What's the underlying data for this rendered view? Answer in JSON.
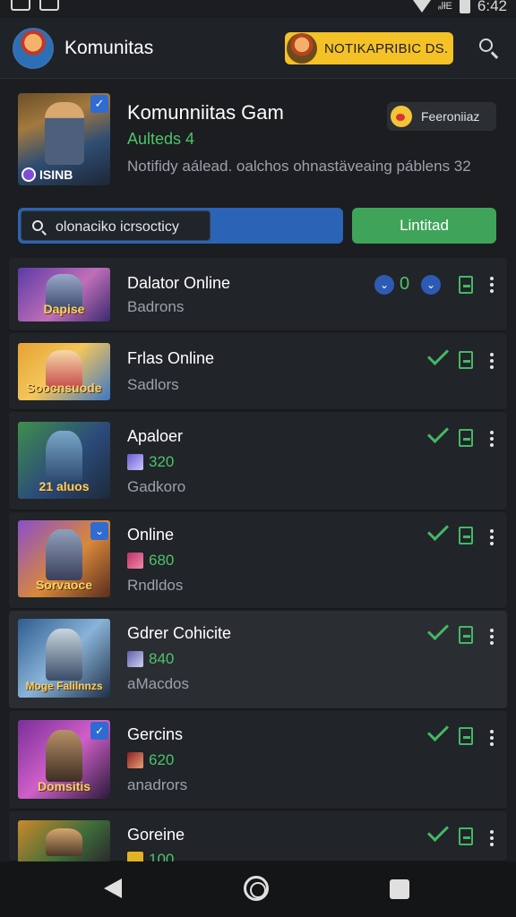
{
  "status_bar": {
    "time": "6:42",
    "signal": "ₐlłE"
  },
  "header": {
    "title": "Komunitas",
    "notification_label": "NOTIKAPRIBIC DS."
  },
  "community": {
    "name": "Komunniitas Gam",
    "subtitle": "Aulteds 4",
    "description": "Notifidy aálead. oalchos ohnastäveaing páblens 32",
    "image_tag": "ISINB",
    "favorite_label": "Feeroniiaz",
    "search_value": "olonaciko icrsocticy",
    "limit_button": "Lintitad"
  },
  "rows": [
    {
      "title": "Dalator Online",
      "count": "",
      "sub": "Badrons",
      "thumb_caption": "Dapise",
      "status": "0"
    },
    {
      "title": "Frlas Online",
      "count": "",
      "sub": "Sadlors",
      "thumb_caption": "Soocnsuode",
      "status": ""
    },
    {
      "title": "Apaloer",
      "count": "320",
      "sub": "Gadkoro",
      "thumb_caption": "21 aluos",
      "status": ""
    },
    {
      "title": "Online",
      "count": "680",
      "sub": "Rndldos",
      "thumb_caption": "Sorvaoce",
      "status": ""
    },
    {
      "title": "Gdrer Cohicite",
      "count": "840",
      "sub": "aMacdos",
      "thumb_caption": "Moge Falilnnzs",
      "status": ""
    },
    {
      "title": "Gercins",
      "count": "620",
      "sub": "anadrors",
      "thumb_caption": "Domsitis",
      "status": ""
    },
    {
      "title": "Goreine",
      "count": "100",
      "sub": "",
      "thumb_caption": "",
      "status": ""
    }
  ]
}
